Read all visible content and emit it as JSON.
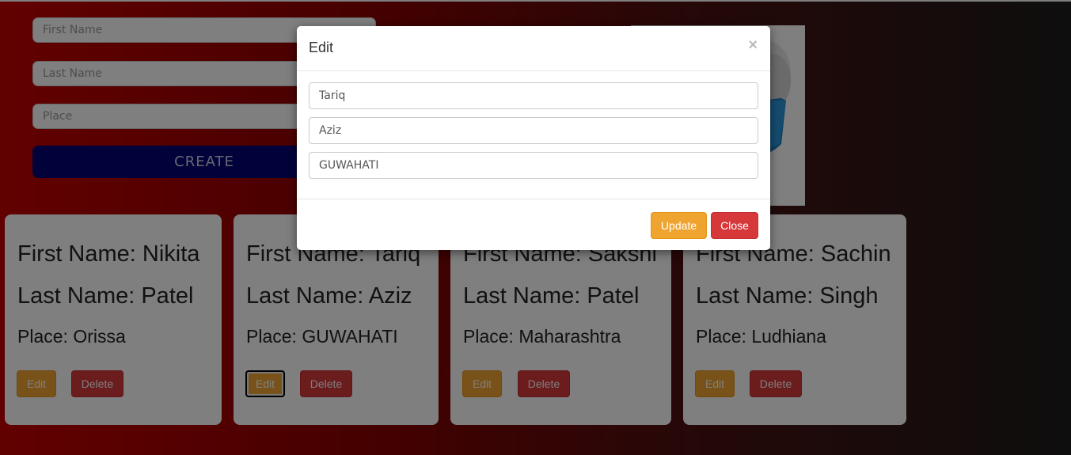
{
  "form": {
    "first_name_placeholder": "First Name",
    "last_name_placeholder": "Last Name",
    "place_placeholder": "Place",
    "create_label": "CREATE"
  },
  "cards": [
    {
      "first_name": "First Name: Nikita",
      "last_name": "Last Name: Patel",
      "place": "Place: Orissa",
      "edit_label": "Edit",
      "delete_label": "Delete"
    },
    {
      "first_name": "First Name: Tariq",
      "last_name": "Last Name: Aziz",
      "place": "Place: GUWAHATI",
      "edit_label": "Edit",
      "delete_label": "Delete"
    },
    {
      "first_name": "First Name: Sakshi",
      "last_name": "Last Name: Patel",
      "place": "Place: Maharashtra",
      "edit_label": "Edit",
      "delete_label": "Delete"
    },
    {
      "first_name": "First Name: Sachin",
      "last_name": "Last Name: Singh",
      "place": "Place: Ludhiana",
      "edit_label": "Edit",
      "delete_label": "Delete"
    }
  ],
  "modal": {
    "title": "Edit",
    "close_icon": "×",
    "first_name_value": "Tariq",
    "last_name_value": "Aziz",
    "place_value": "GUWAHATI",
    "update_label": "Update",
    "close_label": "Close"
  },
  "colors": {
    "create_button": "#050574",
    "edit_button": "#f0a430",
    "delete_button": "#d6383a"
  }
}
